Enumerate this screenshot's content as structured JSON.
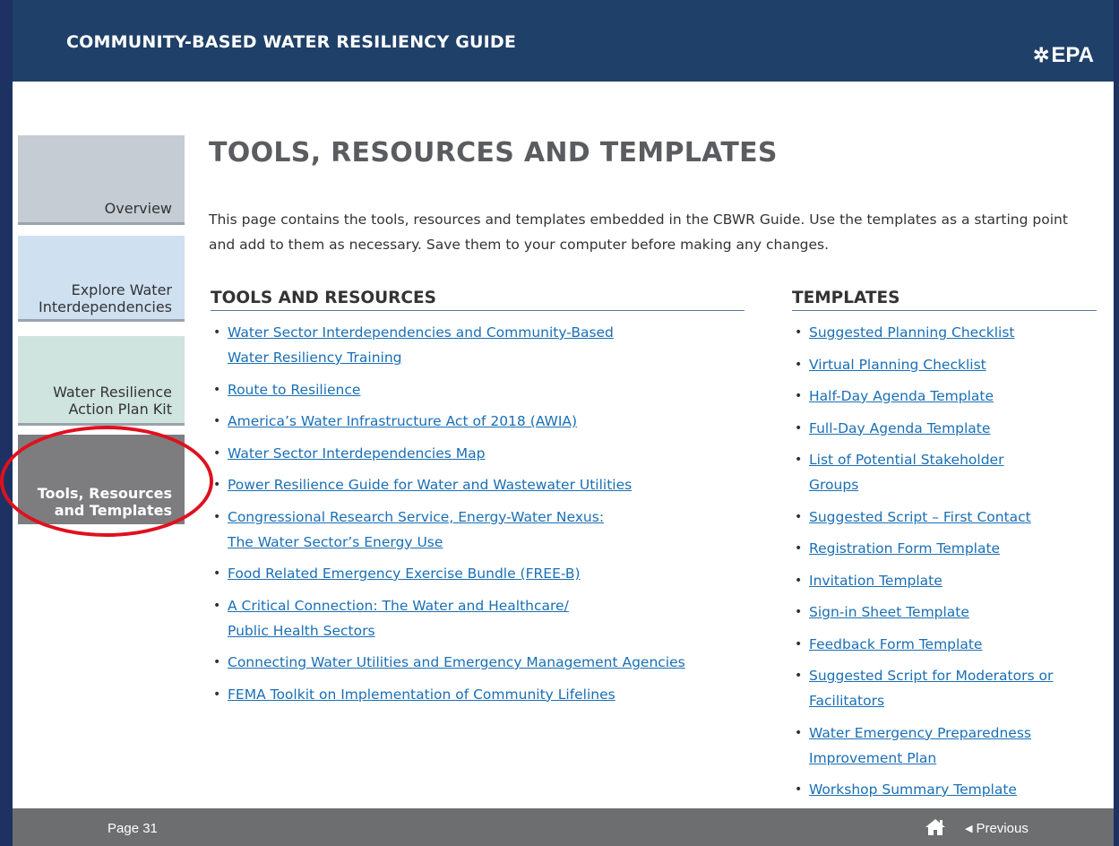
{
  "header": {
    "title": "COMMUNITY-BASED WATER RESILIENCY GUIDE",
    "logo_text": "EPA",
    "logo_icon": "epa-flower-icon"
  },
  "sidebar": {
    "items": [
      {
        "lines": [
          "Overview"
        ],
        "active": false
      },
      {
        "lines": [
          "Explore Water",
          "Interdependencies"
        ],
        "active": false
      },
      {
        "lines": [
          "Water Resilience",
          "Action Plan Kit"
        ],
        "active": false
      },
      {
        "lines": [
          "Tools, Resources",
          "and Templates"
        ],
        "active": true
      }
    ]
  },
  "main": {
    "title": "TOOLS, RESOURCES AND TEMPLATES",
    "intro": "This page contains the tools, resources and templates embedded in the CBWR Guide. Use the templates as a starting point and add to them as necessary. Save them to your computer before making any changes.",
    "tools": {
      "heading": "TOOLS AND RESOURCES",
      "items": [
        [
          "Water Sector Interdependencies and Community-Based",
          "Water Resiliency Training"
        ],
        [
          "Route to Resilience"
        ],
        [
          "America’s Water Infrastructure Act of 2018 (AWIA)"
        ],
        [
          "Water Sector Interdependencies Map"
        ],
        [
          "Power Resilience Guide for Water and Wastewater Utilities"
        ],
        [
          "Congressional Research Service, Energy-Water Nexus:",
          "The Water Sector’s Energy Use"
        ],
        [
          "Food Related Emergency Exercise Bundle (FREE-B)"
        ],
        [
          "A Critical Connection: The Water and Healthcare/",
          "Public Health Sectors"
        ],
        [
          "Connecting Water Utilities and Emergency Management Agencies"
        ],
        [
          "FEMA Toolkit on Implementation of Community Lifelines"
        ]
      ]
    },
    "templates": {
      "heading": "TEMPLATES",
      "items": [
        [
          "Suggested Planning Checklist"
        ],
        [
          "Virtual Planning Checklist"
        ],
        [
          "Half-Day Agenda Template"
        ],
        [
          "Full-Day Agenda Template"
        ],
        [
          "List of Potential Stakeholder",
          "Groups"
        ],
        [
          "Suggested Script – First Contact"
        ],
        [
          "Registration Form Template"
        ],
        [
          "Invitation Template"
        ],
        [
          "Sign-in Sheet Template"
        ],
        [
          "Feedback Form Template"
        ],
        [
          "Suggested Script for Moderators or",
          "Facilitators"
        ],
        [
          "Water Emergency Preparedness",
          "Improvement Plan"
        ],
        [
          "Workshop Summary Template"
        ]
      ]
    }
  },
  "footer": {
    "page_label": "Page 31",
    "home_icon": "home-icon",
    "previous_label": "Previous",
    "previous_icon": "triangle-left-icon"
  },
  "colors": {
    "header_bg": "#1f4068",
    "link": "#1a6fb5",
    "footer_bg": "#6d6e70",
    "active_tab": "#7d7d7f",
    "highlight": "#e0101e"
  }
}
